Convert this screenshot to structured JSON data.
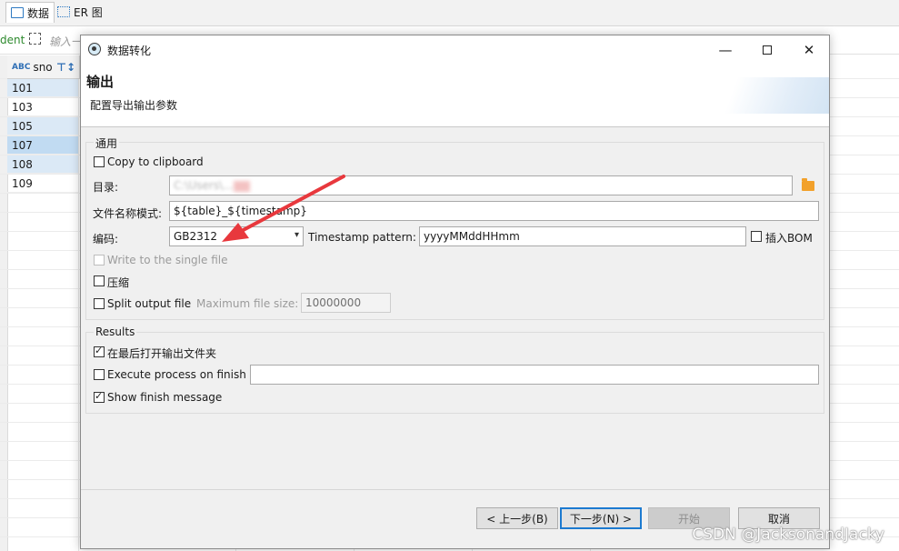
{
  "background_app": {
    "tabs": [
      {
        "label": "数据",
        "icon": "grid-icon"
      },
      {
        "label": "ER 图",
        "icon": "er-diagram-icon"
      }
    ],
    "filter_prefix": "dent",
    "filter_hint": "输入一",
    "column_header": {
      "type_icon": "text-type-icon",
      "type_badge": "ABC",
      "name": "sno",
      "sort_icon": "sort-filter-icon",
      "sort_glyph": "⊤↕"
    },
    "rows": [
      "101",
      "103",
      "105",
      "107",
      "108",
      "109"
    ]
  },
  "dialog": {
    "title": "数据转化",
    "window_controls": {
      "minimize": "—",
      "maximize": "",
      "close": "✕"
    },
    "page_title": "输出",
    "page_subtitle": "配置导出输出参数",
    "general": {
      "group_label": "通用",
      "copy_to_clipboard": {
        "label": "Copy to clipboard",
        "checked": false
      },
      "directory": {
        "label": "目录:",
        "value_visible": "C:\\Users\\...",
        "icon": "folder-icon"
      },
      "file_name_pattern": {
        "label": "文件名称模式:",
        "value": "${table}_${timestamp}"
      },
      "encoding": {
        "label": "编码:",
        "value": "GB2312"
      },
      "timestamp_pattern": {
        "label": "Timestamp pattern:",
        "value": "yyyyMMddHHmm"
      },
      "insert_bom": {
        "label": "插入BOM",
        "checked": false
      },
      "write_single_file": {
        "label": "Write to the single file",
        "checked": false,
        "enabled": false
      },
      "compress": {
        "label": "压缩",
        "checked": false
      },
      "split_output": {
        "label": "Split output file",
        "checked": false
      },
      "max_file_size": {
        "label": "Maximum file size:",
        "value": "10000000",
        "enabled": false
      }
    },
    "results": {
      "group_label": "Results",
      "open_folder": {
        "label": "在最后打开输出文件夹",
        "checked": true
      },
      "execute_process": {
        "label": "Execute process on finish",
        "checked": false,
        "value": ""
      },
      "show_finish": {
        "label": "Show finish message",
        "checked": true
      }
    },
    "buttons": {
      "back": "< 上一步(B)",
      "next": "下一步(N) >",
      "start": "开始",
      "cancel": "取消"
    }
  },
  "annotation": {
    "arrow_color": "#e8383d"
  },
  "watermark": "CSDN @JacksonandJacky",
  "colors": {
    "accent": "#1c7ad0",
    "row_selected": "#c1dbf2",
    "row_alt": "#dbe9f6"
  }
}
